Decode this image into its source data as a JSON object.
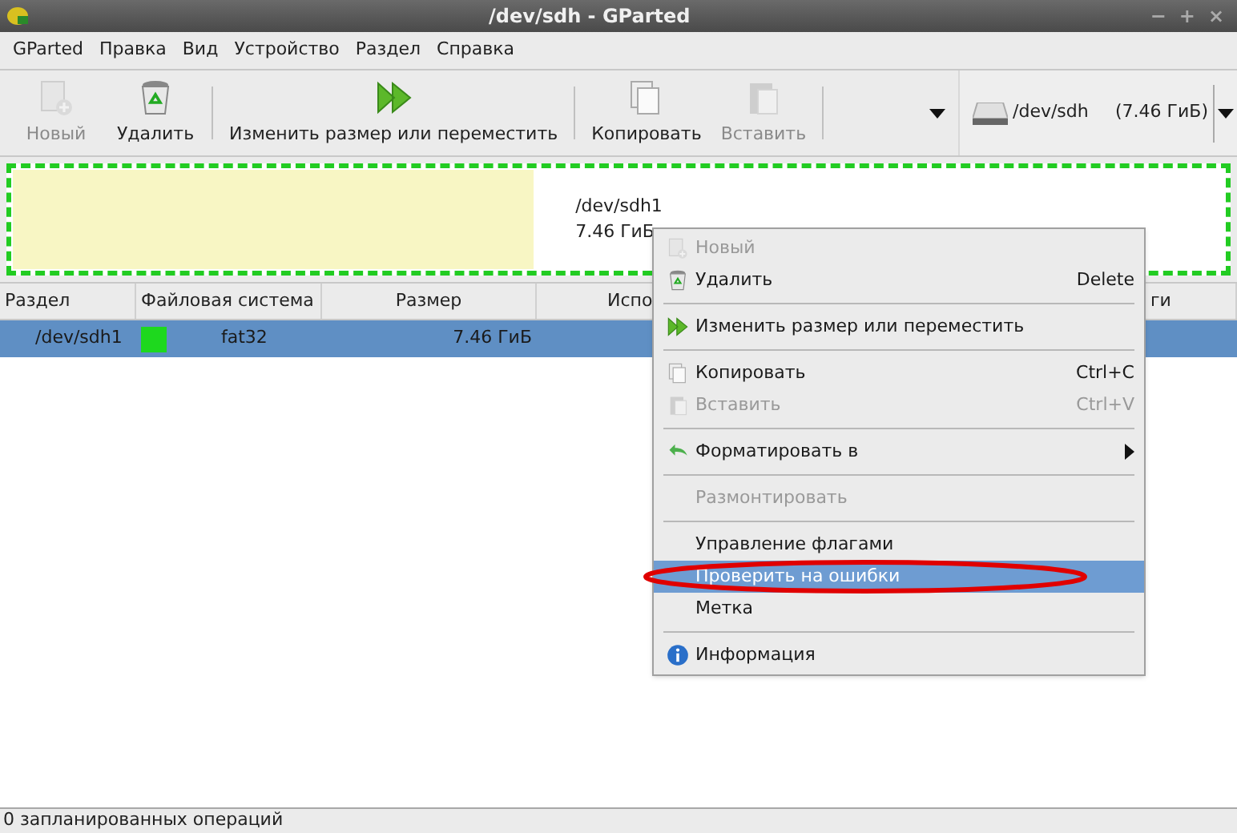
{
  "window": {
    "title": "/dev/sdh - GParted",
    "controls": [
      "−",
      "+",
      "×"
    ]
  },
  "menubar": [
    {
      "label": "GParted"
    },
    {
      "label": "Правка"
    },
    {
      "label": "Вид"
    },
    {
      "label": "Устройство"
    },
    {
      "label": "Раздел"
    },
    {
      "label": "Справка"
    }
  ],
  "toolbar": [
    {
      "kind": "button",
      "label": "Новый",
      "disabled": true
    },
    {
      "kind": "button",
      "label": "Удалить",
      "disabled": false
    },
    {
      "kind": "separator"
    },
    {
      "kind": "button",
      "label": "Изменить размер или переместить",
      "disabled": false
    },
    {
      "kind": "separator"
    },
    {
      "kind": "button",
      "label": "Копировать",
      "disabled": false
    },
    {
      "kind": "button",
      "label": "Вставить",
      "disabled": true
    },
    {
      "kind": "separator"
    },
    {
      "kind": "overflow"
    }
  ],
  "device_selector": {
    "device": "/dev/sdh",
    "size": "(7.46 ГиБ)"
  },
  "partition_map": {
    "name": "/dev/sdh1",
    "size": "7.46 ГиБ",
    "level": 0.43,
    "color": "#22cc22"
  },
  "table": {
    "columns": [
      "Раздел",
      "Файловая система",
      "Размер",
      "Испо",
      "ги"
    ],
    "rows": [
      {
        "partition": "/dev/sdh1",
        "color": "#1ed81e",
        "filesystem": "fat32",
        "size": "7.46 ГиБ",
        "selected": true
      }
    ]
  },
  "context_menu": [
    {
      "kind": "item",
      "label": "Новый",
      "disabled": true,
      "selected": false
    },
    {
      "kind": "item",
      "label": "Удалить",
      "shortcut": "Delete",
      "disabled": false,
      "selected": false
    },
    {
      "kind": "separator"
    },
    {
      "kind": "item",
      "label": "Изменить размер или переместить",
      "disabled": false,
      "selected": false
    },
    {
      "kind": "separator"
    },
    {
      "kind": "item",
      "label": "Копировать",
      "shortcut": "Ctrl+C",
      "disabled": false,
      "selected": false
    },
    {
      "kind": "item",
      "label": "Вставить",
      "shortcut": "Ctrl+V",
      "disabled": true,
      "selected": false
    },
    {
      "kind": "separator"
    },
    {
      "kind": "submenu",
      "label": "Форматировать в",
      "disabled": false,
      "selected": false
    },
    {
      "kind": "separator"
    },
    {
      "kind": "item",
      "label": "Размонтировать",
      "disabled": true,
      "selected": false
    },
    {
      "kind": "separator"
    },
    {
      "kind": "item",
      "label": "Управление флагами",
      "disabled": false,
      "selected": false
    },
    {
      "kind": "item",
      "label": "Проверить на ошибки",
      "disabled": false,
      "selected": true
    },
    {
      "kind": "item",
      "label": "Метка",
      "disabled": false,
      "selected": false
    },
    {
      "kind": "separator"
    },
    {
      "kind": "item",
      "label": "Информация",
      "disabled": false,
      "selected": false
    }
  ],
  "status_bar": "0 запланированных операций"
}
